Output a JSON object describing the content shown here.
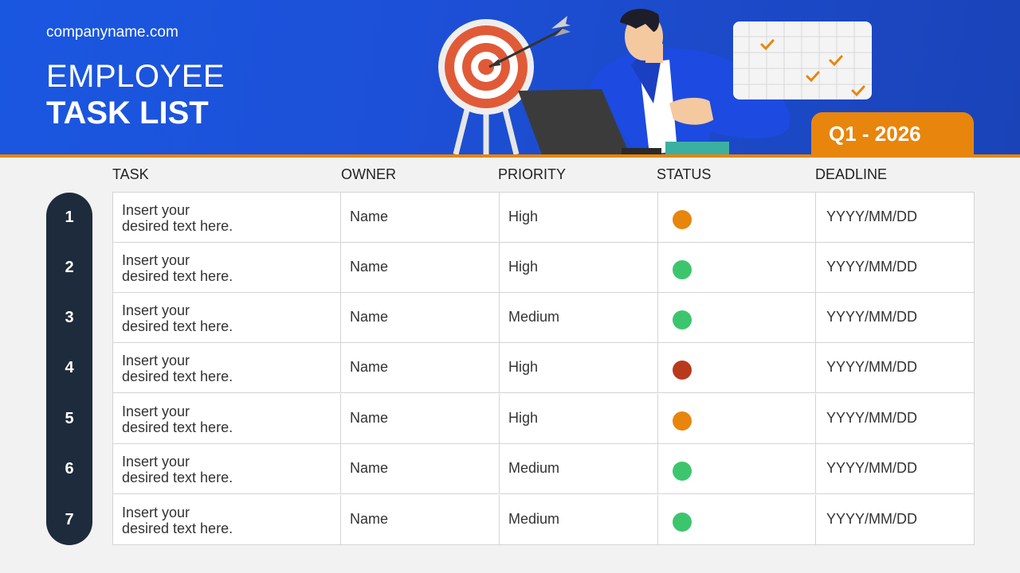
{
  "header": {
    "website": "companyname.com",
    "title_line1": "EMPLOYEE",
    "title_line2": "TASK LIST",
    "quarter": "Q1 - 2026"
  },
  "columns": {
    "task": "TASK",
    "owner": "OWNER",
    "priority": "PRIORITY",
    "status": "STATUS",
    "deadline": "DEADLINE"
  },
  "status_colors": {
    "orange": "#e8850c",
    "green": "#3dc56e",
    "red": "#b83a1c"
  },
  "rows": [
    {
      "num": "1",
      "task_line1": "Insert your",
      "task_line2": "desired text here.",
      "owner": "Name",
      "priority": "High",
      "status": "orange",
      "deadline": "YYYY/MM/DD"
    },
    {
      "num": "2",
      "task_line1": "Insert your",
      "task_line2": "desired text here.",
      "owner": "Name",
      "priority": "High",
      "status": "green",
      "deadline": "YYYY/MM/DD"
    },
    {
      "num": "3",
      "task_line1": "Insert your",
      "task_line2": "desired text here.",
      "owner": "Name",
      "priority": "Medium",
      "status": "green",
      "deadline": "YYYY/MM/DD"
    },
    {
      "num": "4",
      "task_line1": "Insert your",
      "task_line2": "desired text here.",
      "owner": "Name",
      "priority": "High",
      "status": "red",
      "deadline": "YYYY/MM/DD"
    },
    {
      "num": "5",
      "task_line1": "Insert your",
      "task_line2": "desired text here.",
      "owner": "Name",
      "priority": "High",
      "status": "orange",
      "deadline": "YYYY/MM/DD"
    },
    {
      "num": "6",
      "task_line1": "Insert your",
      "task_line2": "desired text here.",
      "owner": "Name",
      "priority": "Medium",
      "status": "green",
      "deadline": "YYYY/MM/DD"
    },
    {
      "num": "7",
      "task_line1": "Insert your",
      "task_line2": "desired text here.",
      "owner": "Name",
      "priority": "Medium",
      "status": "green",
      "deadline": "YYYY/MM/DD"
    }
  ]
}
